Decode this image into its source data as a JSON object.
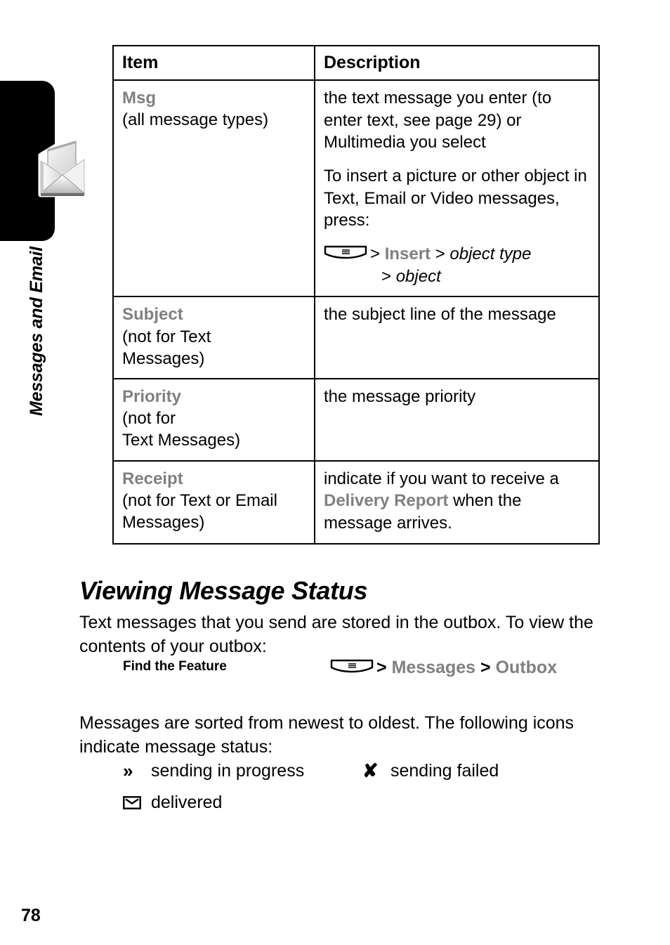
{
  "sidebar": {
    "chapter_title": "Messages and Email",
    "tab_icon": "envelope-with-letter-icon",
    "page_number": "78"
  },
  "table": {
    "headers": [
      "Item",
      "Description"
    ],
    "rows": [
      {
        "term": "Msg",
        "qualifier": "(all message types)",
        "qualifier2": "",
        "desc_p1": "the text message you enter (to enter text, see page 29) or Multimedia you select",
        "desc_p2": "To insert a picture or other object in Text, Email or Video messages, press:",
        "nav_line1_pre": ">",
        "nav_line1_bold": "Insert",
        "nav_line1_post": ">",
        "nav_line1_italic": "object type",
        "nav_line2_pre": ">",
        "nav_line2_italic": "object"
      },
      {
        "term": "Subject",
        "qualifier": "(not for Text",
        "qualifier2": "Messages)",
        "desc_p1": "the subject line of the message"
      },
      {
        "term": "Priority",
        "qualifier": "(not for",
        "qualifier2": "Text Messages)",
        "desc_p1": "the message priority"
      },
      {
        "term": "Receipt",
        "qualifier": "(not for Text or Email",
        "qualifier2": "Messages)",
        "desc_pre": "indicate if you want to receive a",
        "desc_bold": "Delivery Report",
        "desc_post": "when the message arrives."
      }
    ]
  },
  "section": {
    "heading": "Viewing Message Status",
    "intro_paragraph": "Text messages that you send are stored in the outbox. To view the contents of your outbox:",
    "find_the_feature_label": "Find the Feature",
    "find_path": {
      "key_icon": "menu-key-icon",
      "sep1": ">",
      "item1": "Messages",
      "sep2": ">",
      "item2": "Outbox"
    },
    "sorted_paragraph": "Messages are sorted from newest to oldest. The following icons indicate message status:",
    "legend": [
      {
        "icon": "double-chevron-right-icon",
        "glyph": "»",
        "label": "sending in progress"
      },
      {
        "icon": "x-mark-icon",
        "glyph": "✘",
        "label": "sending failed"
      },
      {
        "icon": "envelope-icon",
        "glyph": "",
        "label": "delivered"
      }
    ]
  },
  "colors": {
    "term_gray": "#808080",
    "text_black": "#000000",
    "tab_black": "#000000",
    "page_background": "#ffffff"
  }
}
